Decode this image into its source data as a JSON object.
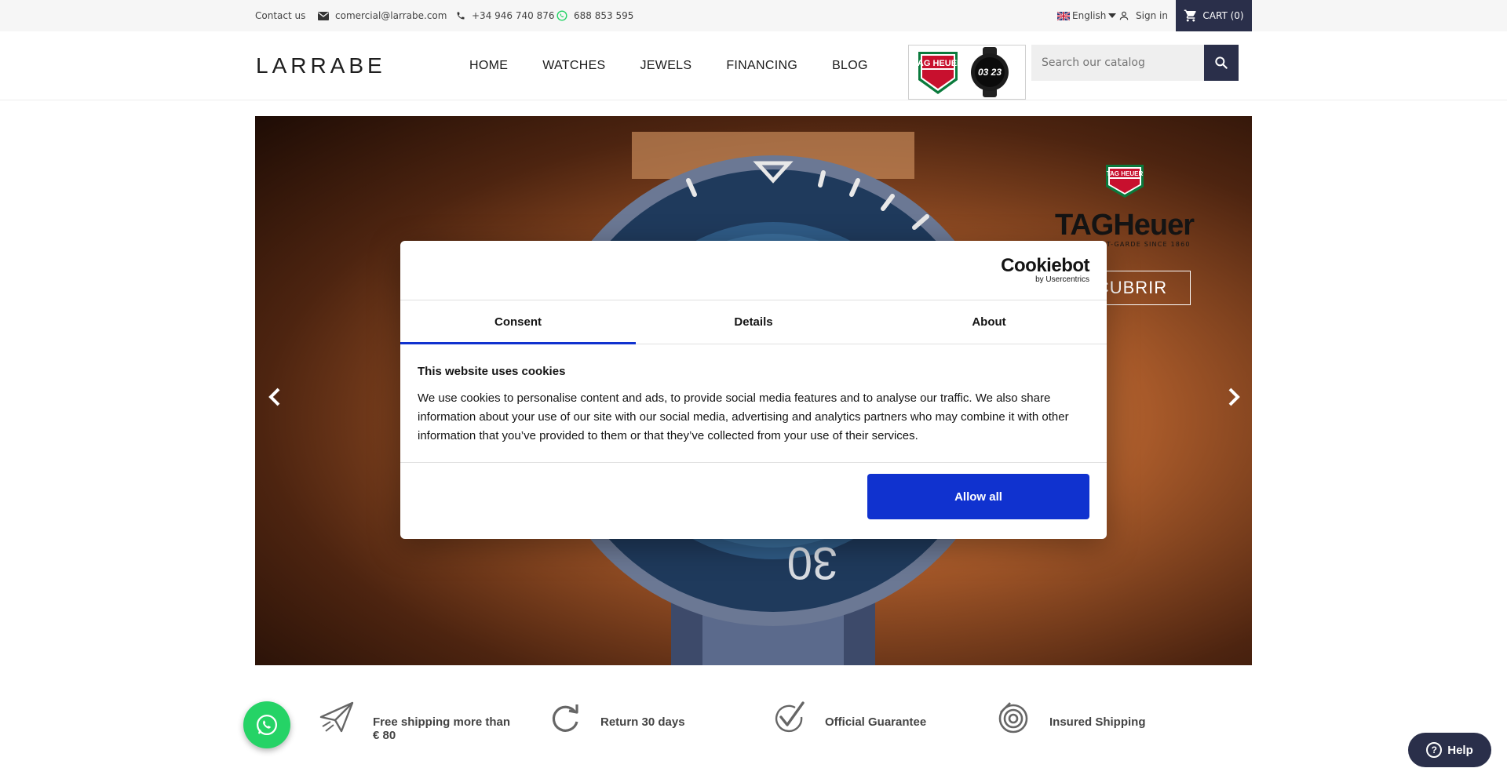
{
  "topbar": {
    "contact_label": "Contact us",
    "email": "comercial@larrabe.com",
    "phone": "+34 946 740 876",
    "whatsapp": "688 853 595",
    "language": "English",
    "sign_in": "Sign in",
    "cart": "CART (0)"
  },
  "header": {
    "logo": "LARRABE",
    "nav": [
      "HOME",
      "WATCHES",
      "JEWELS",
      "FINANCING",
      "BLOG"
    ],
    "banner_brand": "TAG HEUER",
    "banner_watch_time": "03 23",
    "search_placeholder": "Search our catalog"
  },
  "hero": {
    "brand_shield": "TAG HEUER",
    "brand_name": "TAGHeuer",
    "brand_tagline": "SWISS AVANT-GARDE SINCE 1860",
    "cta": "CUBRIR",
    "dial_number": "30"
  },
  "cookie": {
    "logo_main": "Cookiebot",
    "logo_sub": "by Usercentrics",
    "tabs": [
      "Consent",
      "Details",
      "About"
    ],
    "title": "This website uses cookies",
    "text": "We use cookies to personalise content and ads, to provide social media features and to analyse our traffic. We also share information about your use of our site with our social media, advertising and analytics partners who may combine it with other information that you’ve provided to them or that they’ve collected from your use of their services.",
    "allow_all": "Allow all"
  },
  "features": [
    {
      "icon": "paper-plane-icon",
      "line1": "Free shipping more than",
      "line2": "€ 80"
    },
    {
      "icon": "return-arrow-icon",
      "line1": "Return 30 days",
      "line2": ""
    },
    {
      "icon": "checkmark-icon",
      "line1": "Official Guarantee",
      "line2": ""
    },
    {
      "icon": "spiral-icon",
      "line1": "Insured Shipping",
      "line2": ""
    }
  ],
  "help": {
    "label": "Help"
  },
  "colors": {
    "navy": "#2a2f4a",
    "cookie_blue": "#1032cf",
    "whatsapp_green": "#25d366",
    "tag_red": "#c8102e",
    "tag_green": "#0a7a3c"
  }
}
